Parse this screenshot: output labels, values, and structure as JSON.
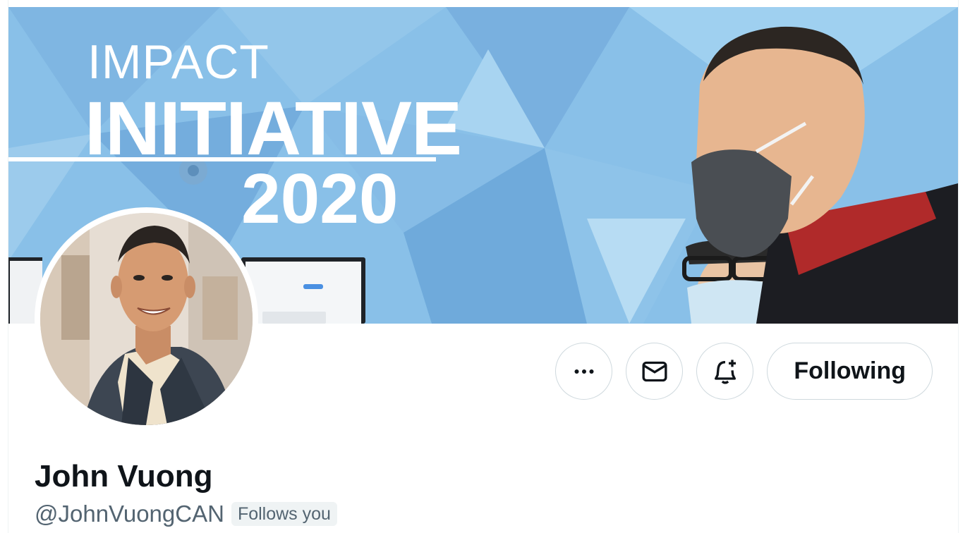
{
  "banner": {
    "line1": "IMPACT",
    "line2": "INITIATIVE",
    "line3": "2020"
  },
  "profile": {
    "display_name": "John Vuong",
    "handle": "@JohnVuongCAN",
    "follows_you_badge": "Follows you"
  },
  "actions": {
    "more_icon": "more-horizontal-icon",
    "message_icon": "envelope-icon",
    "notify_icon": "bell-plus-icon",
    "following_label": "Following"
  },
  "colors": {
    "text_primary": "#0f1419",
    "text_secondary": "#536471",
    "border": "#cfd9de",
    "badge_bg": "#eff3f4",
    "banner_blue": "#86bde6"
  }
}
